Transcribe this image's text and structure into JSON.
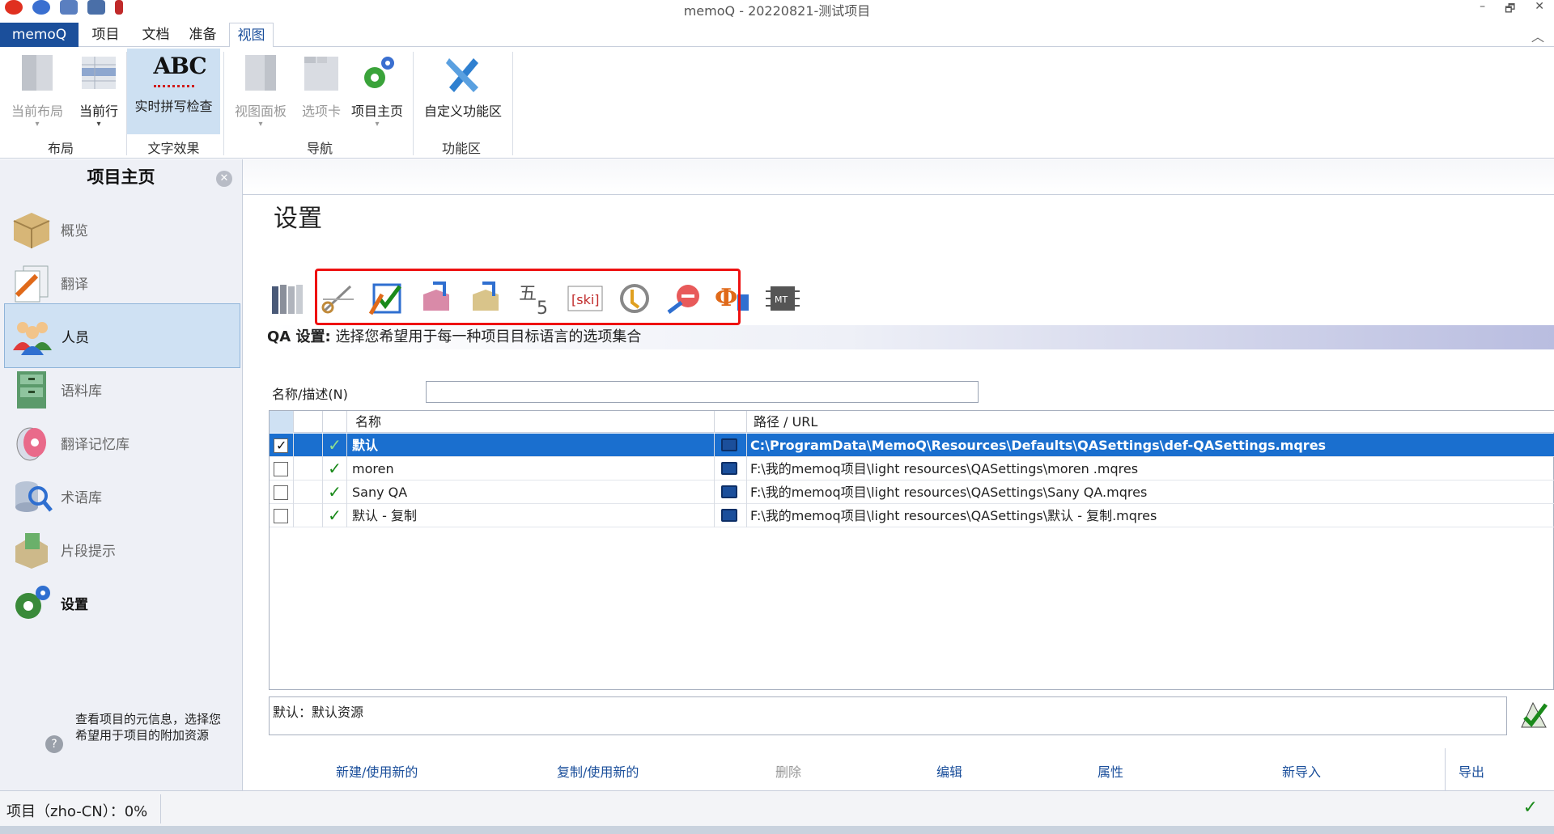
{
  "window": {
    "title": "memoQ - 20220821-测试项目",
    "controls": [
      "–",
      "🗗",
      "✕"
    ]
  },
  "tabs": {
    "memoq": "memoQ",
    "project": "项目",
    "document": "文档",
    "prepare": "准备",
    "view": "视图"
  },
  "ribbon": {
    "buttons": {
      "current_layout": "当前布局",
      "current_row": "当前行",
      "spell_check": "实时拼写检查",
      "spell_icon_text": "ABC",
      "view_panel": "视图面板",
      "tab_card": "选项卡",
      "project_home": "项目主页",
      "customize": "自定义功能区"
    },
    "groups": {
      "layout": "布局",
      "text_effects": "文字效果",
      "navigation": "导航",
      "ribbon_area": "功能区"
    }
  },
  "leftnav": {
    "title": "项目主页",
    "items": [
      "概览",
      "翻译",
      "人员",
      "语料库",
      "翻译记忆库",
      "术语库",
      "片段提示",
      "设置"
    ],
    "selected_index": 2,
    "description": "查看项目的元信息，选择您希望用于项目的附加资源"
  },
  "main": {
    "title": "设置",
    "qa_heading": "QA 设置:",
    "qa_description": "选择您希望用于每一种项目目标语言的选项集合",
    "name_label": "名称/描述(N)",
    "name_value": "",
    "grid": {
      "columns": {
        "name": "名称",
        "path": "路径 / URL"
      },
      "rows": [
        {
          "checked": true,
          "name": "默认",
          "path": "C:\\ProgramData\\MemoQ\\Resources\\Defaults\\QASettings\\def-QASettings.mqres"
        },
        {
          "checked": false,
          "name": "moren",
          "path": "F:\\我的memoq项目\\light resources\\QASettings\\moren .mqres"
        },
        {
          "checked": false,
          "name": "Sany QA",
          "path": "F:\\我的memoq项目\\light resources\\QASettings\\Sany QA.mqres"
        },
        {
          "checked": false,
          "name": "默认 - 复制",
          "path": "F:\\我的memoq项目\\light resources\\QASettings\\默认 - 复制.mqres"
        }
      ]
    },
    "details": "默认：默认资源",
    "actions": {
      "new_use": "新建/使用新的",
      "clone_use": "复制/使用新的",
      "delete": "删除",
      "edit": "编辑",
      "properties": "属性",
      "import_new": "新导入",
      "export": "导出"
    }
  },
  "status": {
    "text": "项目（zho-CN）：0%"
  },
  "colors": {
    "accent": "#1b4f9b",
    "selection": "#1a6fcf",
    "ok_green": "#1a8a1a",
    "highlight_box": "#ee1111"
  }
}
